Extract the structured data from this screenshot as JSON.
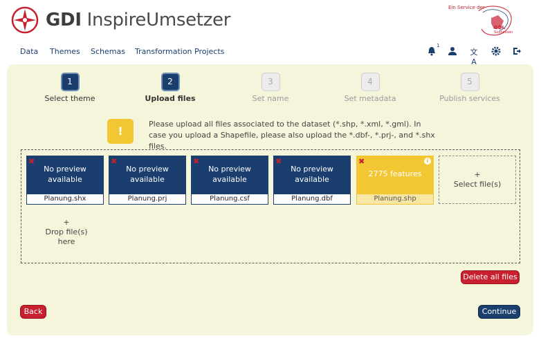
{
  "header": {
    "title_bold": "GDI",
    "title_rest": " InspireUmsetzer",
    "service_text": "Ein Service der",
    "service_org": "GDI.",
    "service_region": "Südhessen"
  },
  "nav": {
    "items": [
      "Data",
      "Themes",
      "Schemas",
      "Transformation Projects"
    ],
    "notification_count": "1"
  },
  "stepper": [
    {
      "number": "1",
      "label": "Select theme",
      "state": "done"
    },
    {
      "number": "2",
      "label": "Upload files",
      "state": "current"
    },
    {
      "number": "3",
      "label": "Set name",
      "state": "pending"
    },
    {
      "number": "4",
      "label": "Set metadata",
      "state": "pending"
    },
    {
      "number": "5",
      "label": "Publish services",
      "state": "pending"
    }
  ],
  "info": {
    "icon_text": "!",
    "message": "Please upload all files associated to the dataset (*.shp, *.xml, *.gml). In case you upload a Shapefile, please also upload the *.dbf-, *.prj-, and *.shx files."
  },
  "files": [
    {
      "name": "Planung.shx",
      "preview": "No preview available"
    },
    {
      "name": "Planung.prj",
      "preview": "No preview available"
    },
    {
      "name": "Planung.csf",
      "preview": "No preview available"
    },
    {
      "name": "Planung.dbf",
      "preview": "No preview available"
    },
    {
      "name": "Planung.shp",
      "preview": "2775 features"
    }
  ],
  "select_files": {
    "plus": "+",
    "label": "Select file(s)"
  },
  "drop_area": {
    "plus": "+",
    "label": "Drop file(s) here"
  },
  "buttons": {
    "delete_all": "Delete all files",
    "back": "Back",
    "continue": "Continue"
  },
  "colors": {
    "primary": "#1a3e6d",
    "danger": "#c8202f",
    "warning": "#f2c733",
    "panel": "#f5f5dc"
  }
}
